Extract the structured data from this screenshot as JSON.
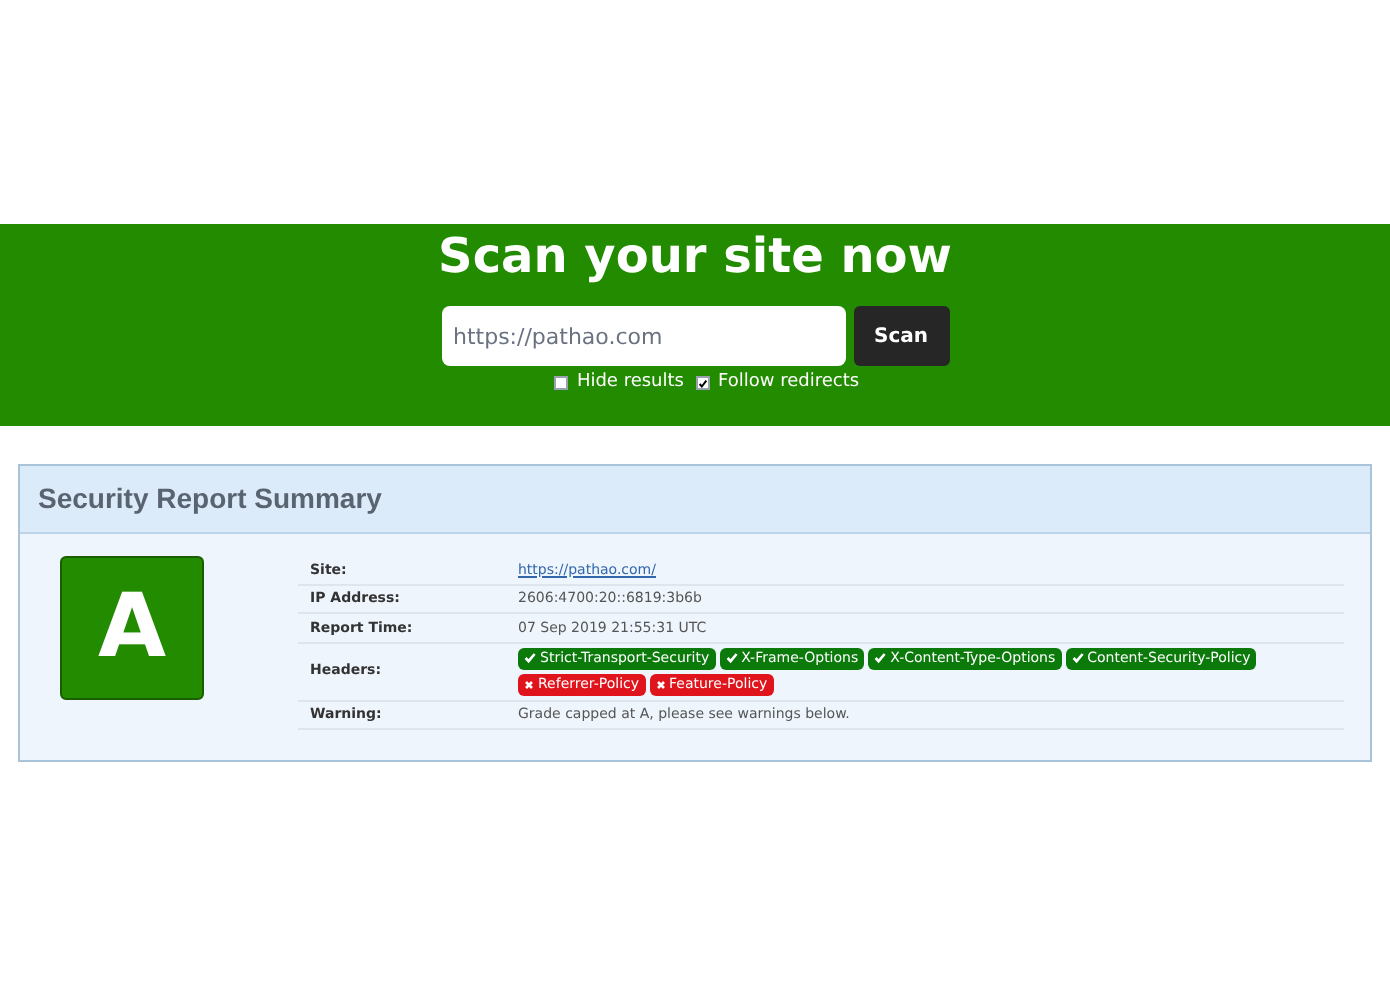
{
  "hero": {
    "title": "Scan your site now",
    "input": {
      "placeholder": "https://pathao.com"
    },
    "button": "Scan",
    "options": [
      {
        "label": "Hide results",
        "checked": false
      },
      {
        "label": "Follow redirects",
        "checked": true
      }
    ]
  },
  "report": {
    "title": "Security Report Summary",
    "grade": "A",
    "rows": [
      {
        "label": "Site:",
        "kind": "link",
        "value": "https://pathao.com/"
      },
      {
        "label": "IP Address:",
        "kind": "text",
        "value": "2606:4700:20::6819:3b6b"
      },
      {
        "label": "Report Time:",
        "kind": "text",
        "value": "07 Sep 2019 21:55:31 UTC"
      },
      {
        "label": "Headers:",
        "kind": "headers",
        "headers": [
          {
            "name": "Strict-Transport-Security",
            "present": true
          },
          {
            "name": "X-Frame-Options",
            "present": true
          },
          {
            "name": "X-Content-Type-Options",
            "present": true
          },
          {
            "name": "Content-Security-Policy",
            "present": true
          },
          {
            "name": "Referrer-Policy",
            "present": false
          },
          {
            "name": "Feature-Policy",
            "present": false
          }
        ]
      },
      {
        "label": "Warning:",
        "kind": "text",
        "value": "Grade capped at A, please see warnings below."
      }
    ]
  }
}
